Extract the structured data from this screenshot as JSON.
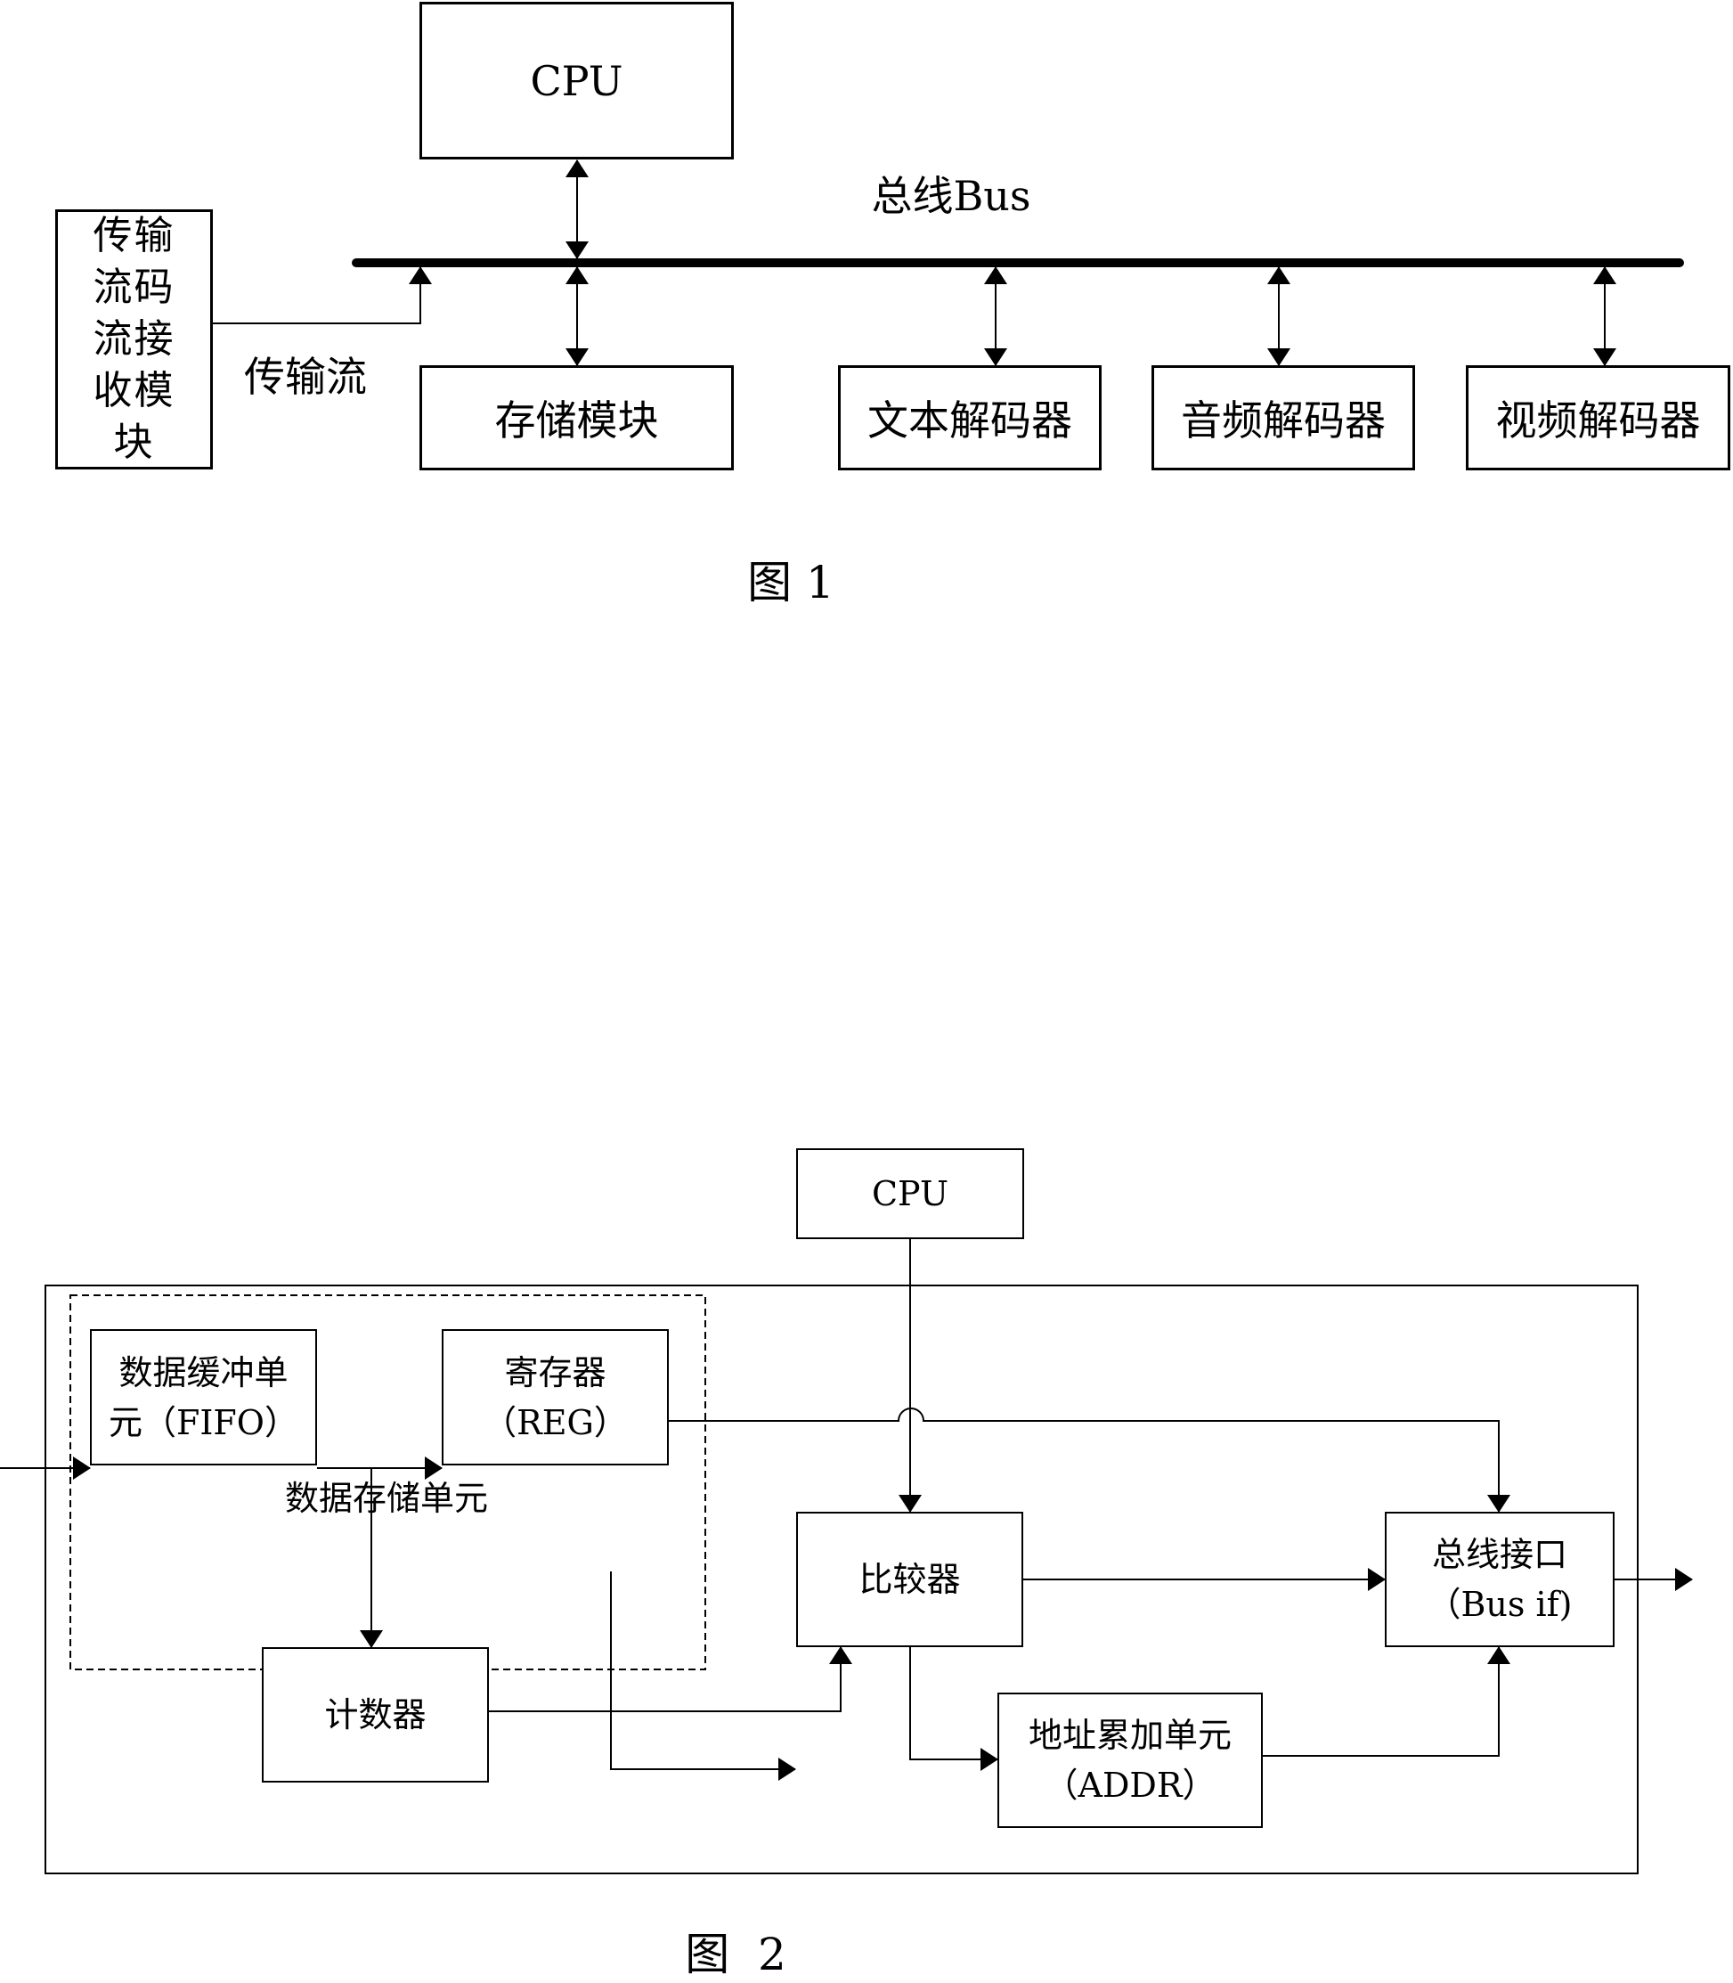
{
  "figure1": {
    "caption": "图 1",
    "cpu": "CPU",
    "bus_label": "总线Bus",
    "receiver": "传输流码流接收模块",
    "stream_label": "传输流",
    "storage": "存储模块",
    "text_decoder": "文本解码器",
    "audio_decoder": "音频解码器",
    "video_decoder": "视频解码器"
  },
  "figure2": {
    "caption": "图  2",
    "cpu": "CPU",
    "fifo_line1": "数据缓冲单",
    "fifo_line2": "元（FIFO）",
    "reg_line1": "寄存器",
    "reg_line2": "（REG）",
    "storage_unit_label": "数据存储单元",
    "comparator": "比较器",
    "counter": "计数器",
    "addr_line1": "地址累加单元",
    "addr_line2": "（ADDR）",
    "busif_line1": "总线接口",
    "busif_line2": "（Bus if)"
  }
}
